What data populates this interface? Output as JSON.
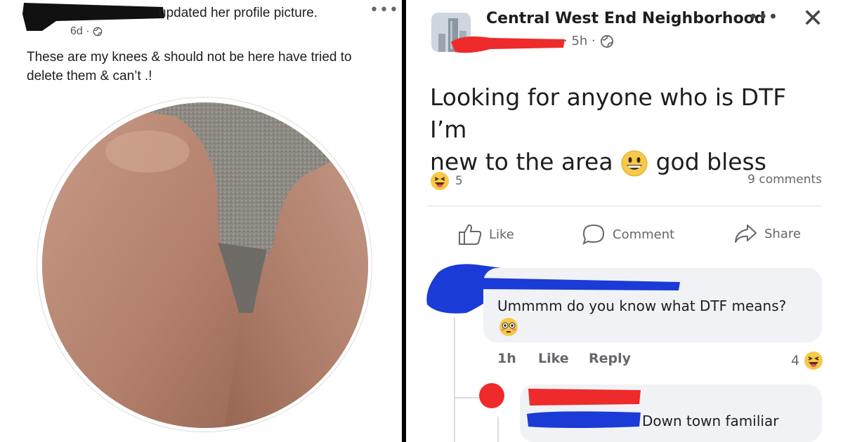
{
  "left_post": {
    "action_text": "updated her profile picture.",
    "time": "6d ·",
    "more_label": "•••",
    "body": "These are my knees & should not be here have tried to delete them & can’t .!"
  },
  "right_post": {
    "group_name": "Central West End Neighborhood",
    "time": "· 5h ·",
    "more_label": "•••",
    "close_label": "✕",
    "body_line1": "Looking for anyone who is DTF I’m",
    "body_line2a": "new to the area",
    "body_line2b": "god bless",
    "reaction_count": "5",
    "comments_count": "9 comments",
    "actions": {
      "like": "Like",
      "comment": "Comment",
      "share": "Share"
    }
  },
  "comments": [
    {
      "text": "Ummmm do you know what DTF means?",
      "time": "1h",
      "like": "Like",
      "reply": "Reply",
      "reaction_count": "4"
    },
    {
      "text": "Down town familiar"
    }
  ],
  "colors": {
    "redact_black": "#111111",
    "redact_red": "#ee2a2a",
    "redact_blue": "#1a3bd6",
    "emoji_yellow": "#f7c948"
  }
}
